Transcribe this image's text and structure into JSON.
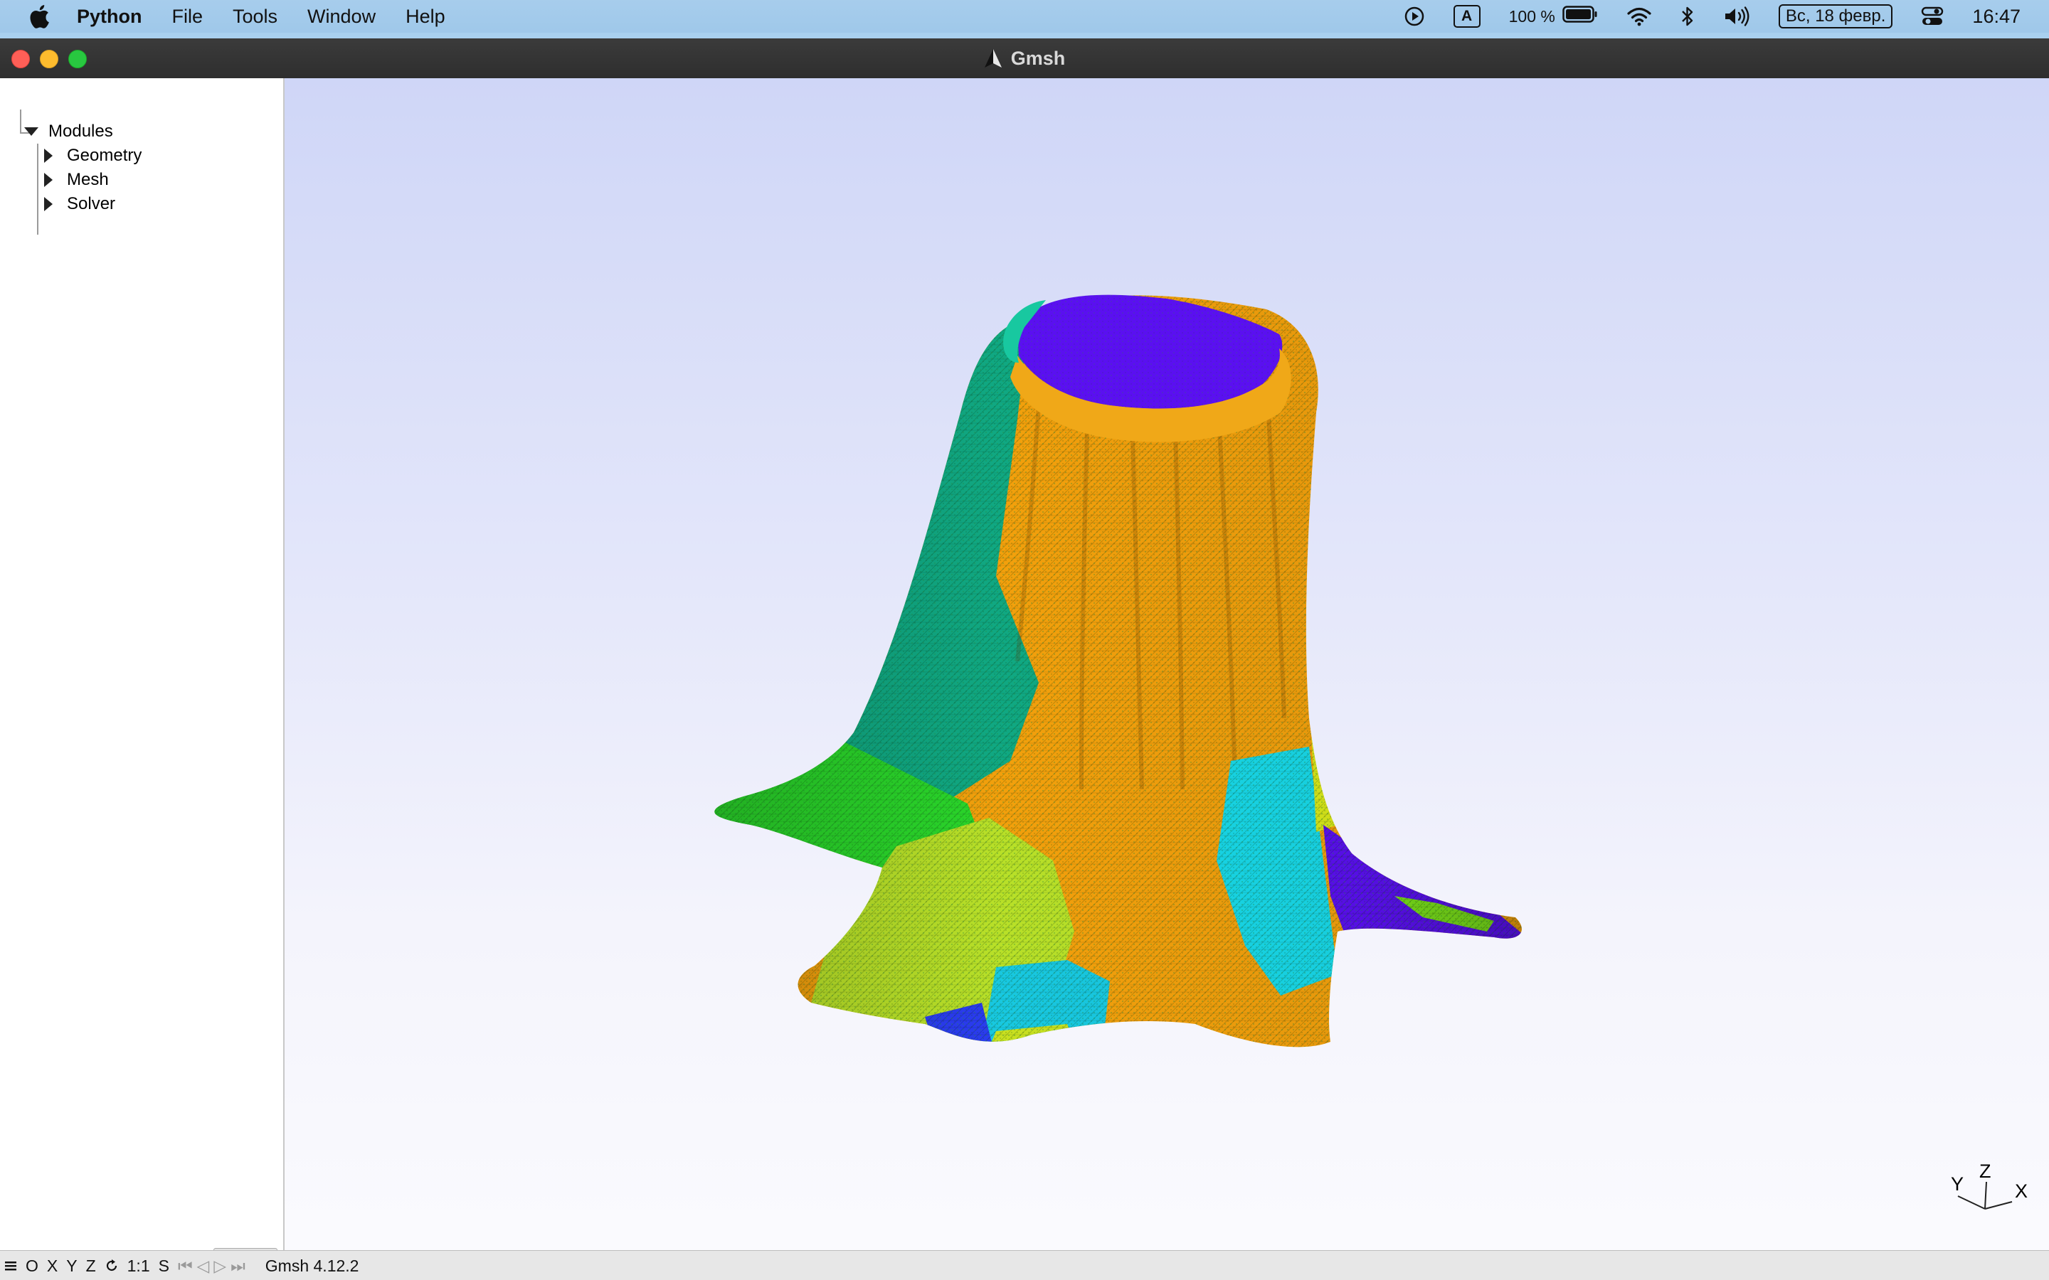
{
  "menubar": {
    "app_name": "Python",
    "items": [
      "File",
      "Tools",
      "Window",
      "Help"
    ],
    "input_source": "A",
    "battery_percent": "100 %",
    "date": "Вс, 18 февр.",
    "time": "16:47"
  },
  "window": {
    "title": "Gmsh"
  },
  "tree": {
    "root_label": "Modules",
    "children": [
      "Geometry",
      "Mesh",
      "Solver"
    ]
  },
  "statusbar": {
    "buttons": [
      "O",
      "X",
      "Y",
      "Z",
      "1:1",
      "S"
    ],
    "version": "Gmsh 4.12.2"
  },
  "axes": {
    "x": "X",
    "y": "Y",
    "z": "Z"
  },
  "colors": {
    "violet": "#5a10f0",
    "orange": "#f2a00c",
    "teal": "#10b890",
    "green": "#2ad62a",
    "yellow_green": "#b0e020",
    "cyan": "#18d8e8",
    "blue": "#2a3cf0"
  }
}
